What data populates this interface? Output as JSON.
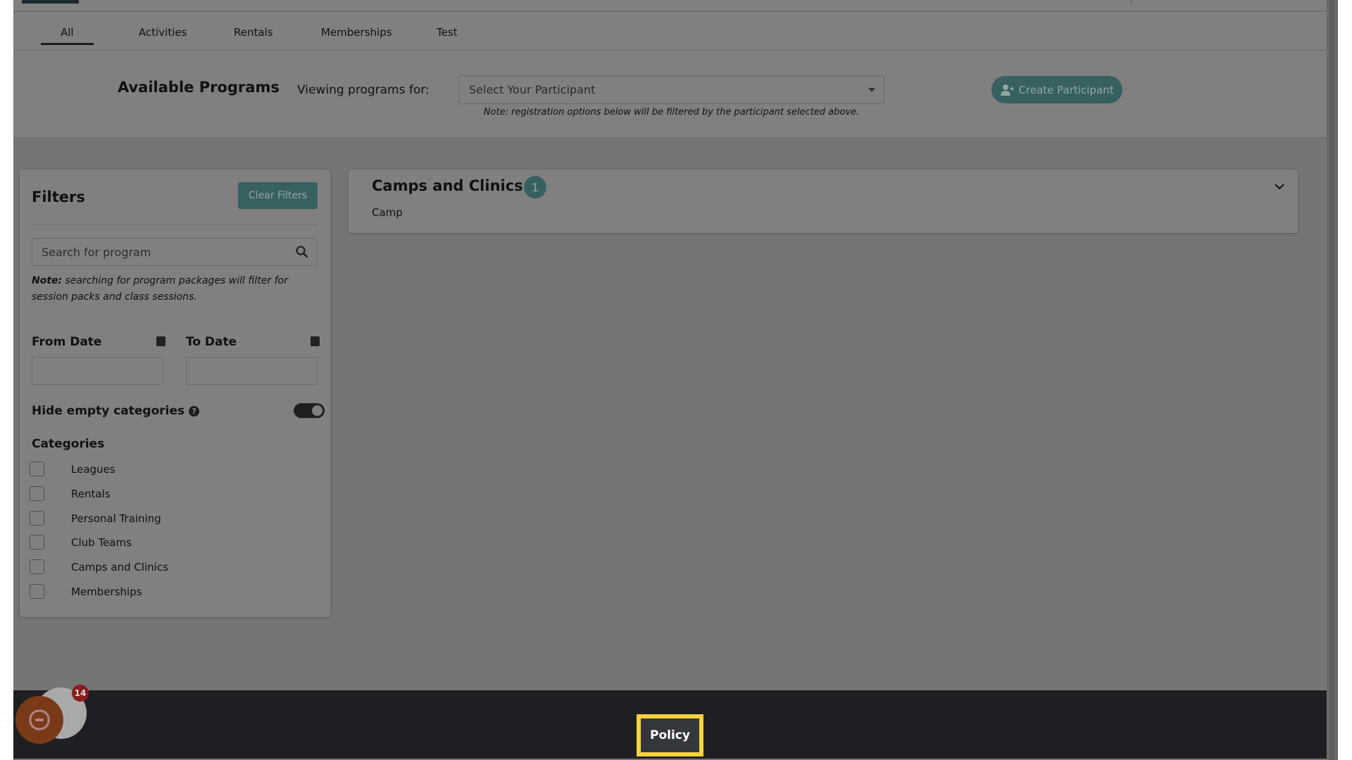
{
  "tabs": [
    {
      "label": "All",
      "active": true
    },
    {
      "label": "Activities"
    },
    {
      "label": "Rentals"
    },
    {
      "label": "Memberships"
    },
    {
      "label": "Test"
    }
  ],
  "header": {
    "title": "Available Programs",
    "viewing_label": "Viewing programs for:",
    "participant_select": "Select Your Participant",
    "note": "Note: registration options below will be filtered by the participant selected above.",
    "create_participant": "Create Participant"
  },
  "filters": {
    "title": "Filters",
    "clear": "Clear Filters",
    "search_placeholder": "Search for program",
    "note_bold": "Note:",
    "note_text": " searching for program packages will filter for session packs and class sessions.",
    "from_date": "From Date",
    "to_date": "To Date",
    "hide_empty": "Hide empty categories",
    "hide_empty_on": true,
    "categories_title": "Categories",
    "categories": [
      "Leagues",
      "Rentals",
      "Personal Training",
      "Club Teams",
      "Camps and Clinics",
      "Memberships"
    ]
  },
  "results": [
    {
      "title": "Camps and Clinics",
      "count": "1",
      "subtitle": "Camp"
    }
  ],
  "footer": {
    "policy": "Policy"
  },
  "chat": {
    "badge": "14"
  },
  "colors": {
    "accent": "#376060",
    "highlight": "#ffd23f",
    "footer": "#1e1f22"
  }
}
